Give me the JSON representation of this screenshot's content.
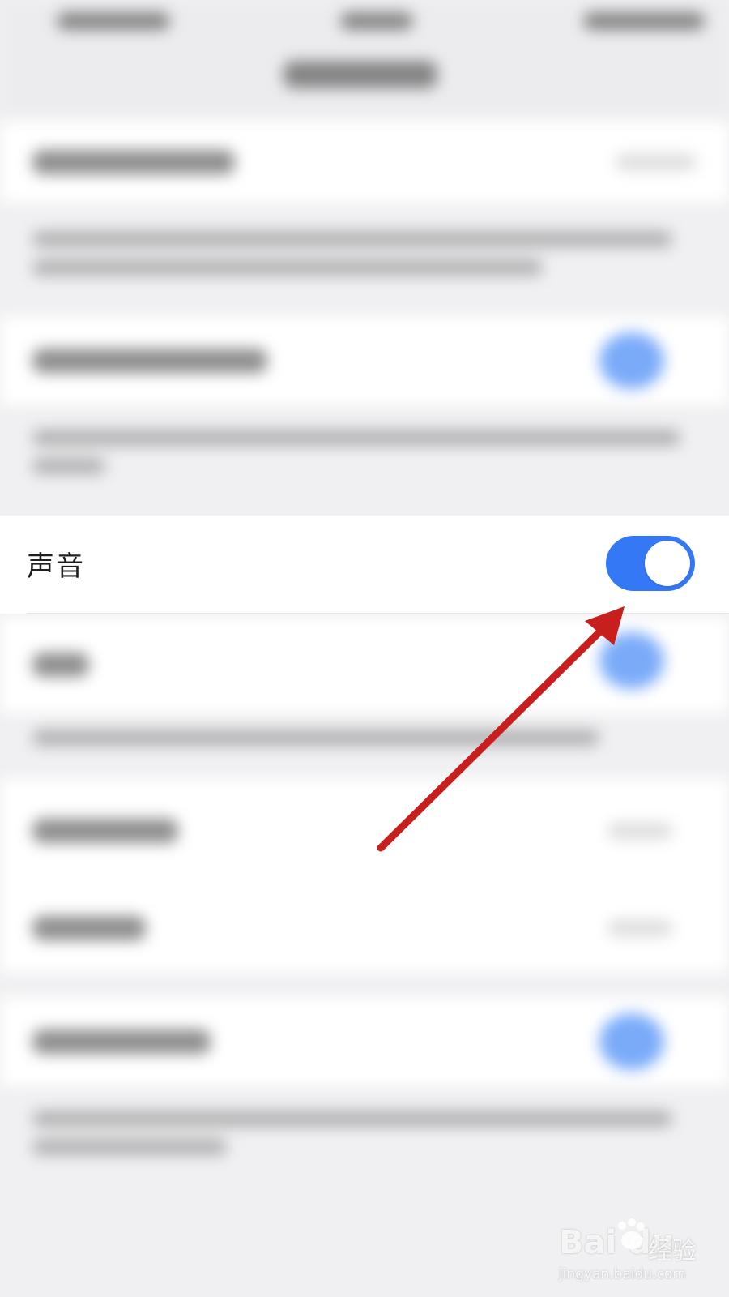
{
  "sound_row": {
    "label": "声音"
  },
  "toggle": {
    "state": "on",
    "on_color": "#3478f6"
  },
  "annotation": {
    "color": "#c81e1e",
    "meaning": "arrow pointing to toggle"
  },
  "watermark": {
    "logo": "Bai du",
    "text": "经验",
    "url": "jingyan.baidu.com"
  }
}
